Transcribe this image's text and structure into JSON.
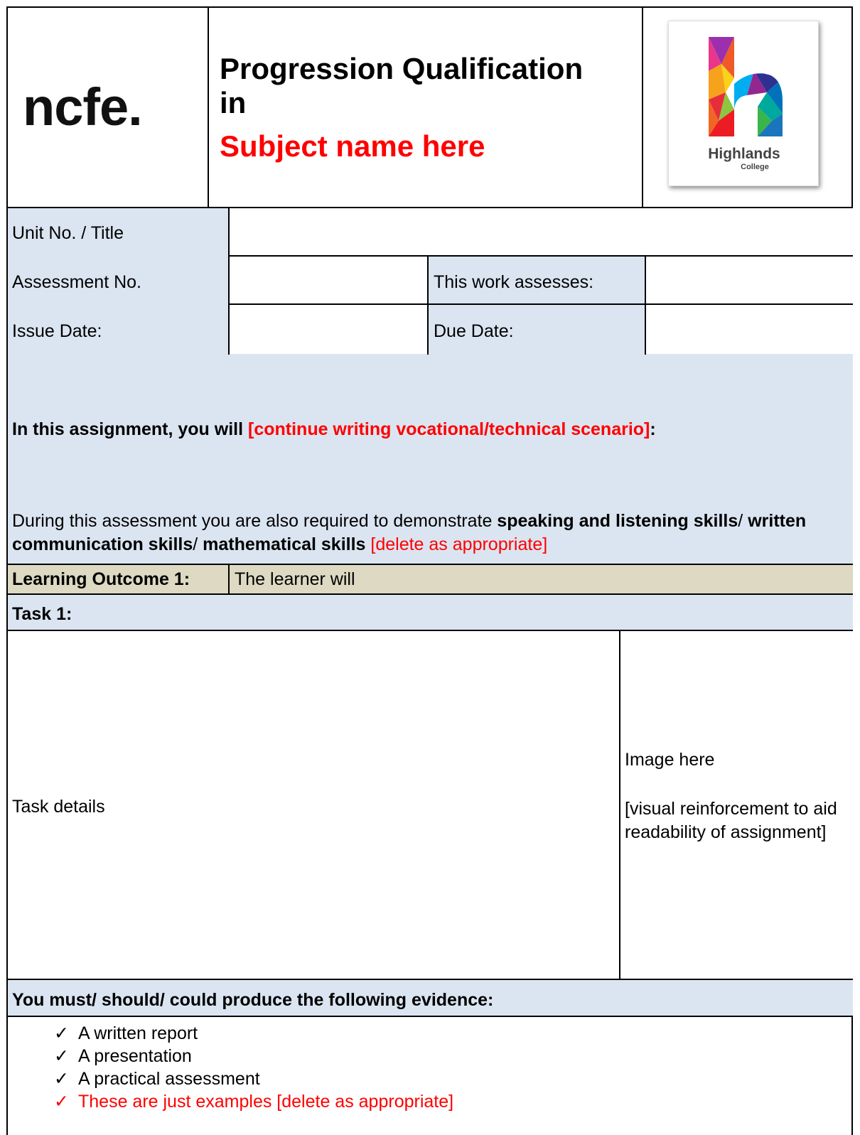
{
  "header": {
    "ncfe_logo_text": "ncfe.",
    "title_line1": "Progression Qualification",
    "title_line2": "in",
    "subject": "Subject name here",
    "college_logo": {
      "name": "Highlands",
      "sub": "College"
    }
  },
  "info": {
    "unit_label": "Unit No. / Title",
    "unit_value": "",
    "assessment_no_label": "Assessment No.",
    "assessment_no_value": "",
    "assesses_label": "This work assesses:",
    "assesses_value": "",
    "issue_date_label": "Issue Date:",
    "issue_date_value": "",
    "due_date_label": "Due Date:",
    "due_date_value": ""
  },
  "scenario": {
    "lead": "In this assignment, you will ",
    "placeholder": "[continue writing vocational/technical scenario]",
    "tail": ":"
  },
  "skills": {
    "intro": "During this assessment you are also required to demonstrate ",
    "skill1": "speaking and listening skills",
    "sep1": "/ ",
    "skill2": "written communication skills",
    "sep2": "/ ",
    "skill3": "mathematical skills",
    "note": " [delete as appropriate]"
  },
  "learning_outcome": {
    "label": "Learning Outcome 1:",
    "value": "The learner will"
  },
  "task": {
    "label": "Task 1:",
    "details": "Task details",
    "image_placeholder": "Image here",
    "image_note": "[visual reinforcement to aid readability of assignment]"
  },
  "evidence": {
    "heading": "You must/ should/ could produce the following evidence:",
    "check_glyph": "✓",
    "items": [
      {
        "text": "A written report",
        "red": false
      },
      {
        "text": "A presentation",
        "red": false
      },
      {
        "text": "A practical assessment",
        "red": false
      },
      {
        "text": "These are just examples [delete as appropriate]",
        "red": true
      }
    ]
  },
  "colors": {
    "label_fill": "#dbe5f1",
    "outcome_fill": "#ddd9c3",
    "accent_red": "#ff0000"
  }
}
